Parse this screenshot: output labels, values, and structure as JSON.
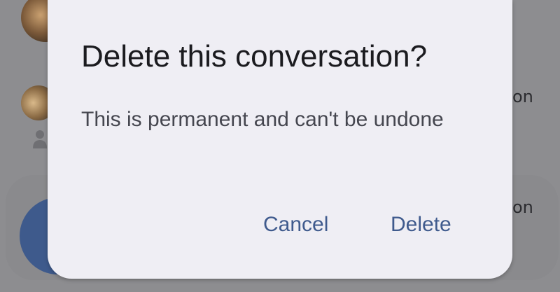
{
  "background": {
    "row_1_partial_text": "on",
    "row_2_partial_text": "on"
  },
  "dialog": {
    "title": "Delete this conversation?",
    "message": "This is permanent and can't be undone",
    "cancel_label": "Cancel",
    "delete_label": "Delete"
  },
  "colors": {
    "dialog_background": "#efeef4",
    "title_text": "#1b1b1f",
    "body_text": "#45464f",
    "action_text": "#3f5a8d",
    "scrim": "#8d8d90",
    "fab": "#3e5a8c"
  },
  "icons": {
    "contact_placeholder": "person-icon"
  }
}
